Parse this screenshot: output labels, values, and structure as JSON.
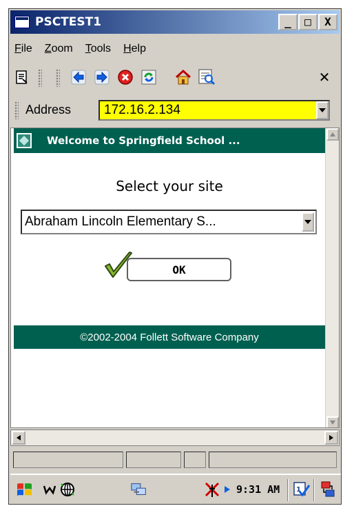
{
  "window": {
    "title": "PSCTEST1",
    "minimize_label": "_",
    "maximize_label": "□",
    "close_label": "X"
  },
  "menu": {
    "items": [
      {
        "label": "File",
        "underline": "F",
        "rest": "ile"
      },
      {
        "label": "Zoom",
        "underline": "Z",
        "rest": "oom"
      },
      {
        "label": "Tools",
        "underline": "T",
        "rest": "ools"
      },
      {
        "label": "Help",
        "underline": "H",
        "rest": "elp"
      }
    ]
  },
  "toolbar": {
    "icons": [
      "page-icon",
      "back-arrow-icon",
      "forward-arrow-icon",
      "stop-icon",
      "refresh-icon",
      "home-icon",
      "favorites-icon"
    ],
    "close_label": "✕"
  },
  "address": {
    "label": "Address",
    "value": "172.16.2.134",
    "highlight_color": "#ffff00"
  },
  "page": {
    "banner_title": "Welcome to Springfield School ...",
    "heading": "Select your site",
    "site_selected": "Abraham Lincoln Elementary S...",
    "ok_label": "OK",
    "footer": "©2002-2004 Follett Software Company",
    "banner_color": "#006050"
  },
  "taskbar": {
    "icons": [
      "windows-flag-icon",
      "w-icon",
      "globe-icon",
      "network-icon",
      "antenna-icon",
      "volume-icon",
      "checkmark-note-icon",
      "sync-icon"
    ],
    "time": "9:31 AM"
  }
}
